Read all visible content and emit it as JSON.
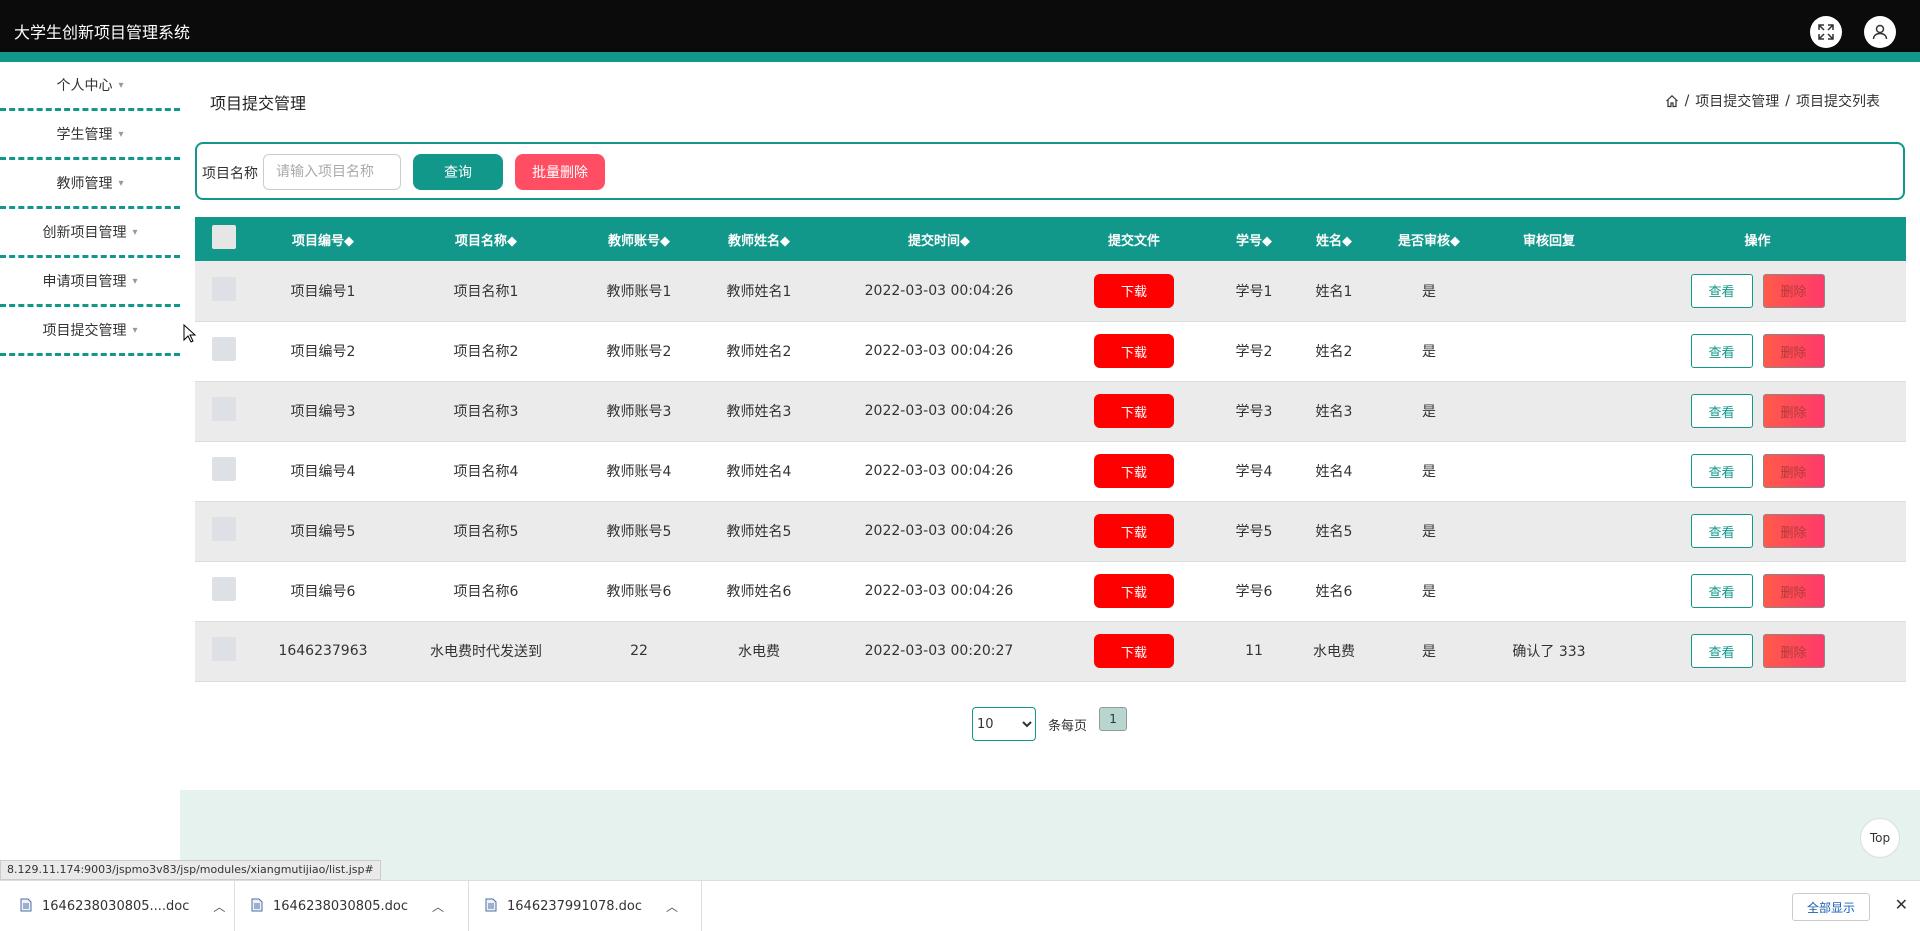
{
  "header": {
    "title": "大学生创新项目管理系统",
    "icons": [
      "fullscreen-icon",
      "user-icon"
    ]
  },
  "sidebar": {
    "items": [
      {
        "label": "个人中心"
      },
      {
        "label": "学生管理"
      },
      {
        "label": "教师管理"
      },
      {
        "label": "创新项目管理"
      },
      {
        "label": "申请项目管理"
      },
      {
        "label": "项目提交管理"
      }
    ]
  },
  "main": {
    "page_title": "项目提交管理",
    "breadcrumb": {
      "sep": "/",
      "crumb1": "项目提交管理",
      "crumb2": "项目提交列表"
    },
    "search": {
      "label": "项目名称",
      "placeholder": "请输入项目名称",
      "value": "",
      "query_label": "查询",
      "batch_delete_label": "批量删除"
    },
    "table": {
      "columns": [
        "项目编号◆",
        "项目名称◆",
        "教师账号◆",
        "教师姓名◆",
        "提交时间◆",
        "提交文件",
        "学号◆",
        "姓名◆",
        "是否审核◆",
        "审核回复",
        "操作"
      ],
      "download_label": "下载",
      "view_label": "查看",
      "delete_label": "删除",
      "rows": [
        {
          "code": "项目编号1",
          "name": "项目名称1",
          "account": "教师账号1",
          "teacher": "教师姓名1",
          "time": "2022-03-03 00:04:26",
          "student_no": "学号1",
          "student": "姓名1",
          "reviewed": "是",
          "reply": ""
        },
        {
          "code": "项目编号2",
          "name": "项目名称2",
          "account": "教师账号2",
          "teacher": "教师姓名2",
          "time": "2022-03-03 00:04:26",
          "student_no": "学号2",
          "student": "姓名2",
          "reviewed": "是",
          "reply": ""
        },
        {
          "code": "项目编号3",
          "name": "项目名称3",
          "account": "教师账号3",
          "teacher": "教师姓名3",
          "time": "2022-03-03 00:04:26",
          "student_no": "学号3",
          "student": "姓名3",
          "reviewed": "是",
          "reply": ""
        },
        {
          "code": "项目编号4",
          "name": "项目名称4",
          "account": "教师账号4",
          "teacher": "教师姓名4",
          "time": "2022-03-03 00:04:26",
          "student_no": "学号4",
          "student": "姓名4",
          "reviewed": "是",
          "reply": ""
        },
        {
          "code": "项目编号5",
          "name": "项目名称5",
          "account": "教师账号5",
          "teacher": "教师姓名5",
          "time": "2022-03-03 00:04:26",
          "student_no": "学号5",
          "student": "姓名5",
          "reviewed": "是",
          "reply": ""
        },
        {
          "code": "项目编号6",
          "name": "项目名称6",
          "account": "教师账号6",
          "teacher": "教师姓名6",
          "time": "2022-03-03 00:04:26",
          "student_no": "学号6",
          "student": "姓名6",
          "reviewed": "是",
          "reply": ""
        },
        {
          "code": "1646237963",
          "name": "水电费时代发送到",
          "account": "22",
          "teacher": "水电费",
          "time": "2022-03-03 00:20:27",
          "student_no": "11",
          "student": "水电费",
          "reviewed": "是",
          "reply": "确认了 333"
        }
      ]
    },
    "pagination": {
      "page_size": "10",
      "page_size_options": [
        "10"
      ],
      "per_page_label": "条每页",
      "current_page": "1"
    },
    "top_button": "Top"
  },
  "status_url": "8.129.11.174:9003/jspmo3v83/jsp/modules/xiangmutijiao/list.jsp#",
  "downloads": {
    "files": [
      "1646238030805....doc",
      "1646238030805.doc",
      "1646237991078.doc"
    ],
    "show_all_label": "全部显示"
  },
  "colors": {
    "accent": "#12988a",
    "danger": "#ff0000",
    "batch_delete": "#ff4e63",
    "header_bg": "#0b0b0b"
  }
}
